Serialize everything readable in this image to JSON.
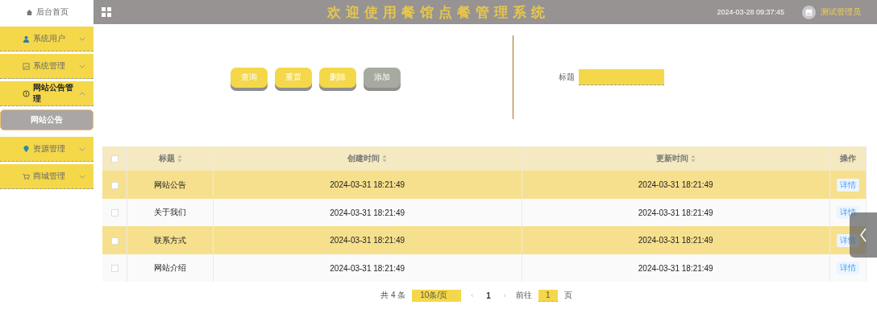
{
  "sidebar": {
    "home": "后台首页",
    "menus": [
      {
        "label": "系统用户",
        "expanded": false
      },
      {
        "label": "系统管理",
        "expanded": false
      },
      {
        "label": "网站公告管理",
        "expanded": true,
        "children": [
          {
            "label": "网站公告",
            "selected": true
          }
        ]
      },
      {
        "label": "资源管理",
        "expanded": false
      },
      {
        "label": "商城管理",
        "expanded": false
      }
    ]
  },
  "header": {
    "title": "欢迎使用餐馆点餐管理系统",
    "datetime": "2024-03-28 09:37:45",
    "user": "测试管理员"
  },
  "actions": [
    "查询",
    "重置",
    "删除",
    "添加"
  ],
  "search": {
    "label": "标题"
  },
  "table": {
    "select_all_checked": false,
    "columns": [
      "标题",
      "创建时间",
      "更新时间",
      "操作"
    ],
    "rows": [
      {
        "checked": false,
        "title": "网站公告",
        "created": "2024-03-31 18:21:49",
        "updated": "2024-03-31 18:21:49",
        "action": "详情"
      },
      {
        "checked": false,
        "title": "关于我们",
        "created": "2024-03-31 18:21:49",
        "updated": "2024-03-31 18:21:49",
        "action": "详情"
      },
      {
        "checked": false,
        "title": "联系方式",
        "created": "2024-03-31 18:21:49",
        "updated": "2024-03-31 18:21:49",
        "action": "详情"
      },
      {
        "checked": false,
        "title": "网站介绍",
        "created": "2024-03-31 18:21:49",
        "updated": "2024-03-31 18:21:49",
        "action": "详情"
      }
    ]
  },
  "pagination": {
    "total": "共 4 条",
    "page_size": "10条/页",
    "prev": "‹",
    "page": "1",
    "next": "›",
    "goto": "前往",
    "goto_value": "1",
    "page_unit": "页"
  }
}
